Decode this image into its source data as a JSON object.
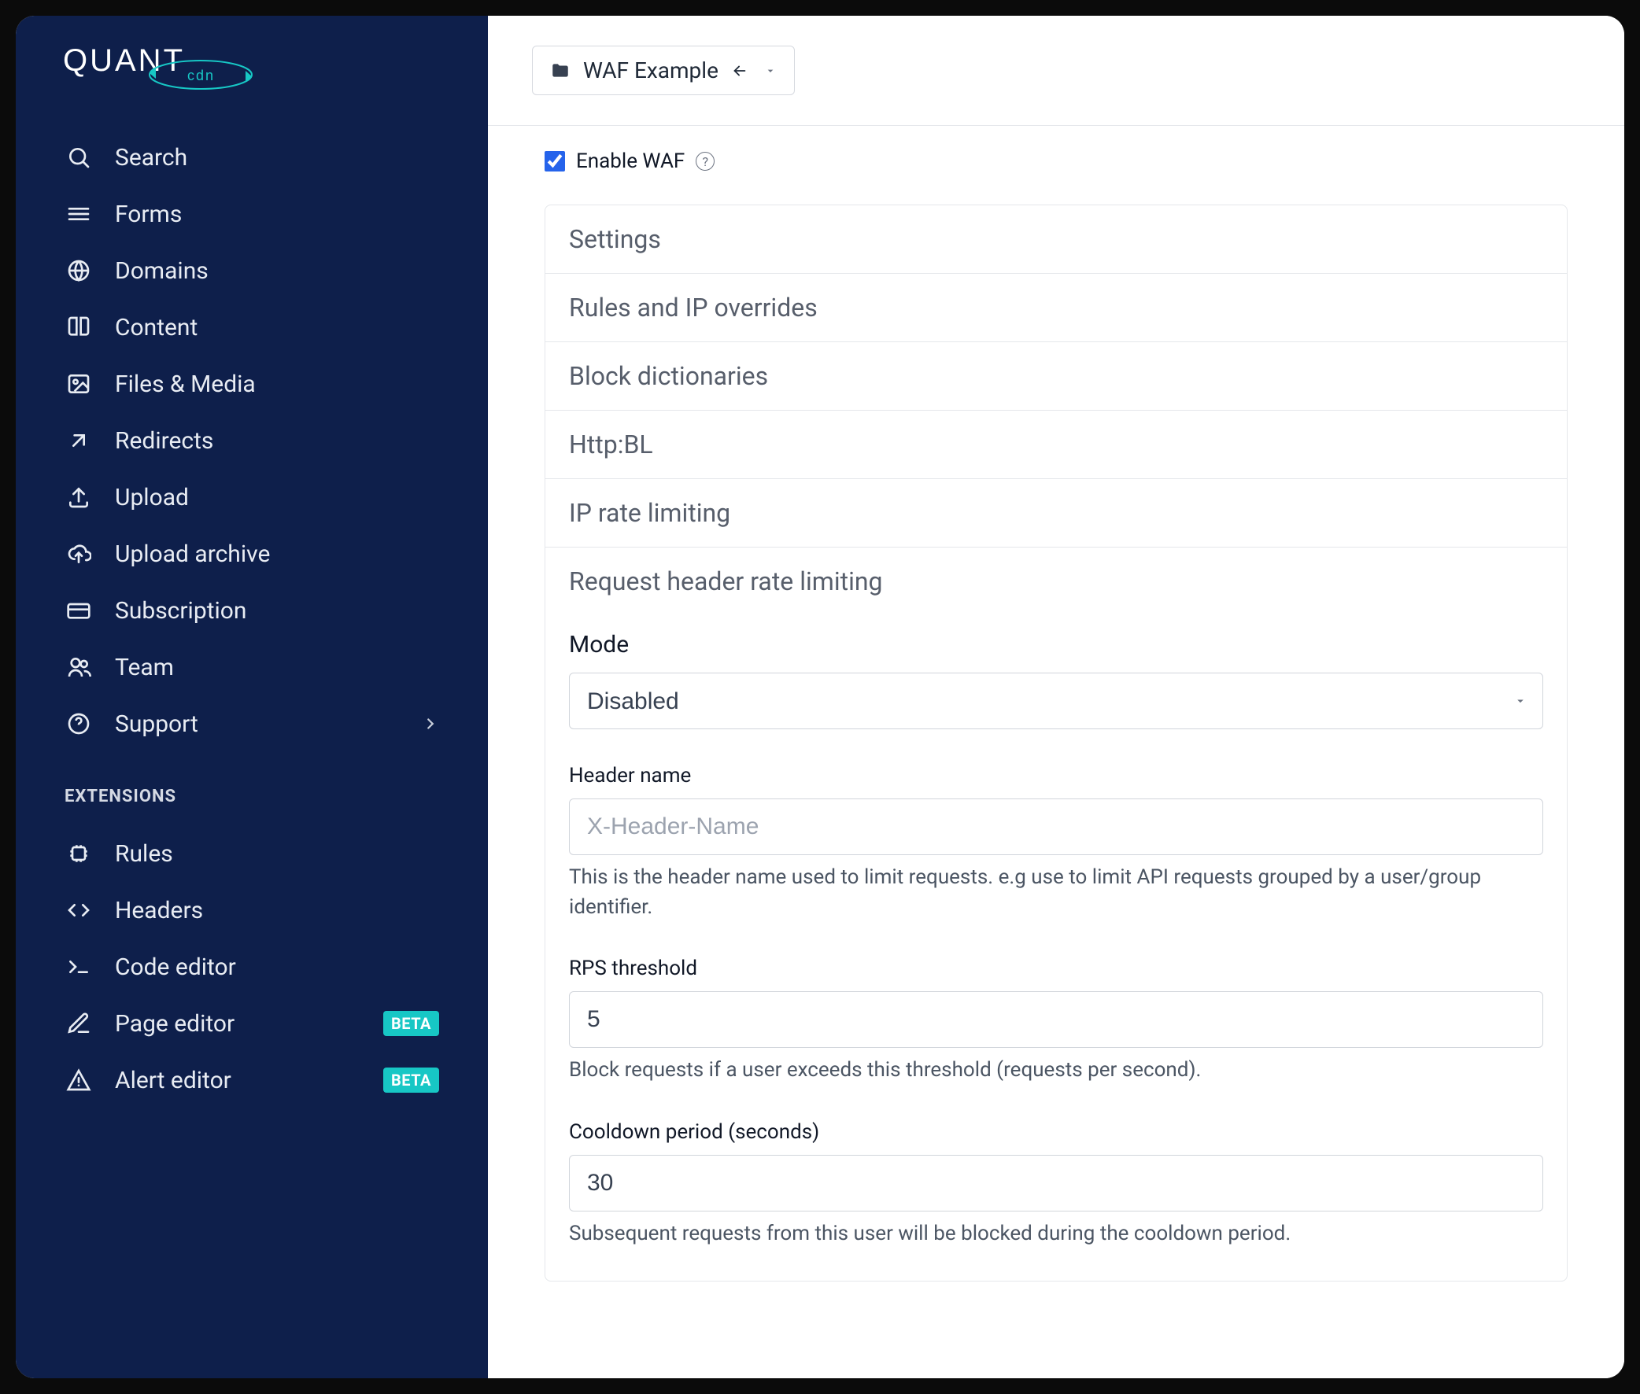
{
  "brand": {
    "name": "QUANT",
    "sub": "cdn"
  },
  "sidebar": {
    "items": [
      {
        "label": "Search"
      },
      {
        "label": "Forms"
      },
      {
        "label": "Domains"
      },
      {
        "label": "Content"
      },
      {
        "label": "Files & Media"
      },
      {
        "label": "Redirects"
      },
      {
        "label": "Upload"
      },
      {
        "label": "Upload archive"
      },
      {
        "label": "Subscription"
      },
      {
        "label": "Team"
      },
      {
        "label": "Support"
      }
    ],
    "extensions_header": "EXTENSIONS",
    "extensions": [
      {
        "label": "Rules"
      },
      {
        "label": "Headers"
      },
      {
        "label": "Code editor"
      },
      {
        "label": "Page editor",
        "badge": "BETA"
      },
      {
        "label": "Alert editor",
        "badge": "BETA"
      }
    ]
  },
  "topbar": {
    "project": "WAF Example"
  },
  "waf": {
    "enable_label": "Enable WAF",
    "sections": {
      "settings": "Settings",
      "rules": "Rules and IP overrides",
      "block_dicts": "Block dictionaries",
      "httpbl": "Http:BL",
      "ip_rate": "IP rate limiting",
      "header_rate": "Request header rate limiting"
    },
    "form": {
      "mode": {
        "label": "Mode",
        "value": "Disabled"
      },
      "header_name": {
        "label": "Header name",
        "placeholder": "X-Header-Name",
        "help": "This is the header name used to limit requests. e.g use to limit API requests grouped by a user/group identifier."
      },
      "rps": {
        "label": "RPS threshold",
        "value": "5",
        "help": "Block requests if a user exceeds this threshold (requests per second)."
      },
      "cooldown": {
        "label": "Cooldown period (seconds)",
        "value": "30",
        "help": "Subsequent requests from this user will be blocked during the cooldown period."
      }
    }
  }
}
